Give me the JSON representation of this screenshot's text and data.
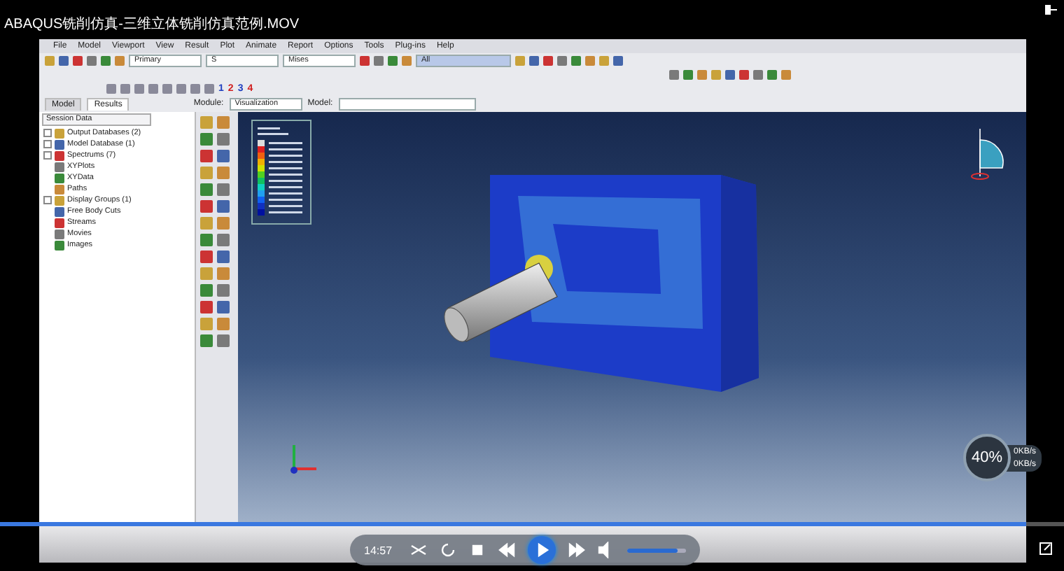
{
  "player": {
    "title": "ABAQUS铣削仿真-三维立体铣削仿真范例.MOV",
    "time": "14:57",
    "progress": {
      "level": 0.965
    },
    "volume": {
      "level": 0.85
    },
    "buffer": {
      "percent": "40%",
      "rates": [
        "0KB/s",
        "0KB/s"
      ]
    }
  },
  "app": {
    "menu": [
      "File",
      "Model",
      "Viewport",
      "View",
      "Result",
      "Plot",
      "Animate",
      "Report",
      "Options",
      "Tools",
      "Plug-ins",
      "Help"
    ],
    "toolbar": {
      "step_field": "Primary",
      "variable_field": "S",
      "invariant_field": "Mises",
      "option_field": "All",
      "layer_numbers": [
        {
          "text": "1",
          "color": "#2040c0"
        },
        {
          "text": "2",
          "color": "#d02020"
        },
        {
          "text": "3",
          "color": "#2040c0"
        },
        {
          "text": "4",
          "color": "#d02020"
        }
      ]
    },
    "tabs": [
      {
        "label": "Model",
        "selected": false
      },
      {
        "label": "Results",
        "selected": true
      }
    ],
    "module_label": "Module:",
    "module": "Visualization",
    "model_label": "Model:",
    "tree_header": "Session Data",
    "tree": [
      {
        "label": "Output Databases (2)",
        "expandable": true
      },
      {
        "label": "Model Database (1)",
        "expandable": true
      },
      {
        "label": "Spectrums (7)",
        "expandable": true
      },
      {
        "label": "XYPlots",
        "expandable": false
      },
      {
        "label": "XYData",
        "expandable": false
      },
      {
        "label": "Paths",
        "expandable": false
      },
      {
        "label": "Display Groups (1)",
        "expandable": true
      },
      {
        "label": "Free Body Cuts",
        "expandable": false
      },
      {
        "label": "Streams",
        "expandable": false
      },
      {
        "label": "Movies",
        "expandable": false
      },
      {
        "label": "Images",
        "expandable": false
      }
    ]
  }
}
